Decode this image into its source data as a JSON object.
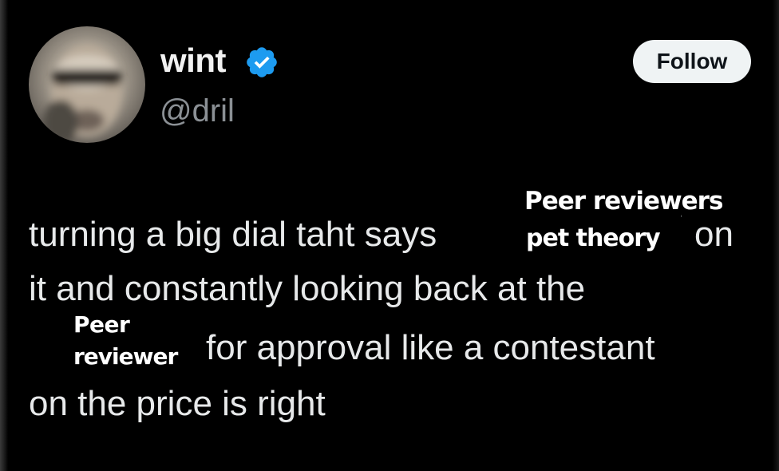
{
  "tweet": {
    "author": {
      "display_name": "wint",
      "handle": "@dril",
      "verified": true,
      "verified_icon": "verified-badge-icon",
      "avatar": "profile-avatar"
    },
    "follow_label": "Follow",
    "text_lines": [
      "turning a big dial taht says",
      "on",
      "it and constantly looking back at the",
      "for approval like a contestant",
      "on the price is right"
    ]
  },
  "overlays": {
    "dial_label": [
      "Peer reviewers",
      "pet theory"
    ],
    "audience_label": [
      "Peer",
      "reviewer"
    ]
  },
  "colors": {
    "background": "#000000",
    "text": "#e7e9ea",
    "handle": "#8b9095",
    "verified_badge": "#1d9bf0",
    "follow_button_bg": "#eff3f4",
    "follow_button_text": "#0f1419",
    "overlay_text": "#ffffff",
    "overlay_outline": "#000000"
  }
}
